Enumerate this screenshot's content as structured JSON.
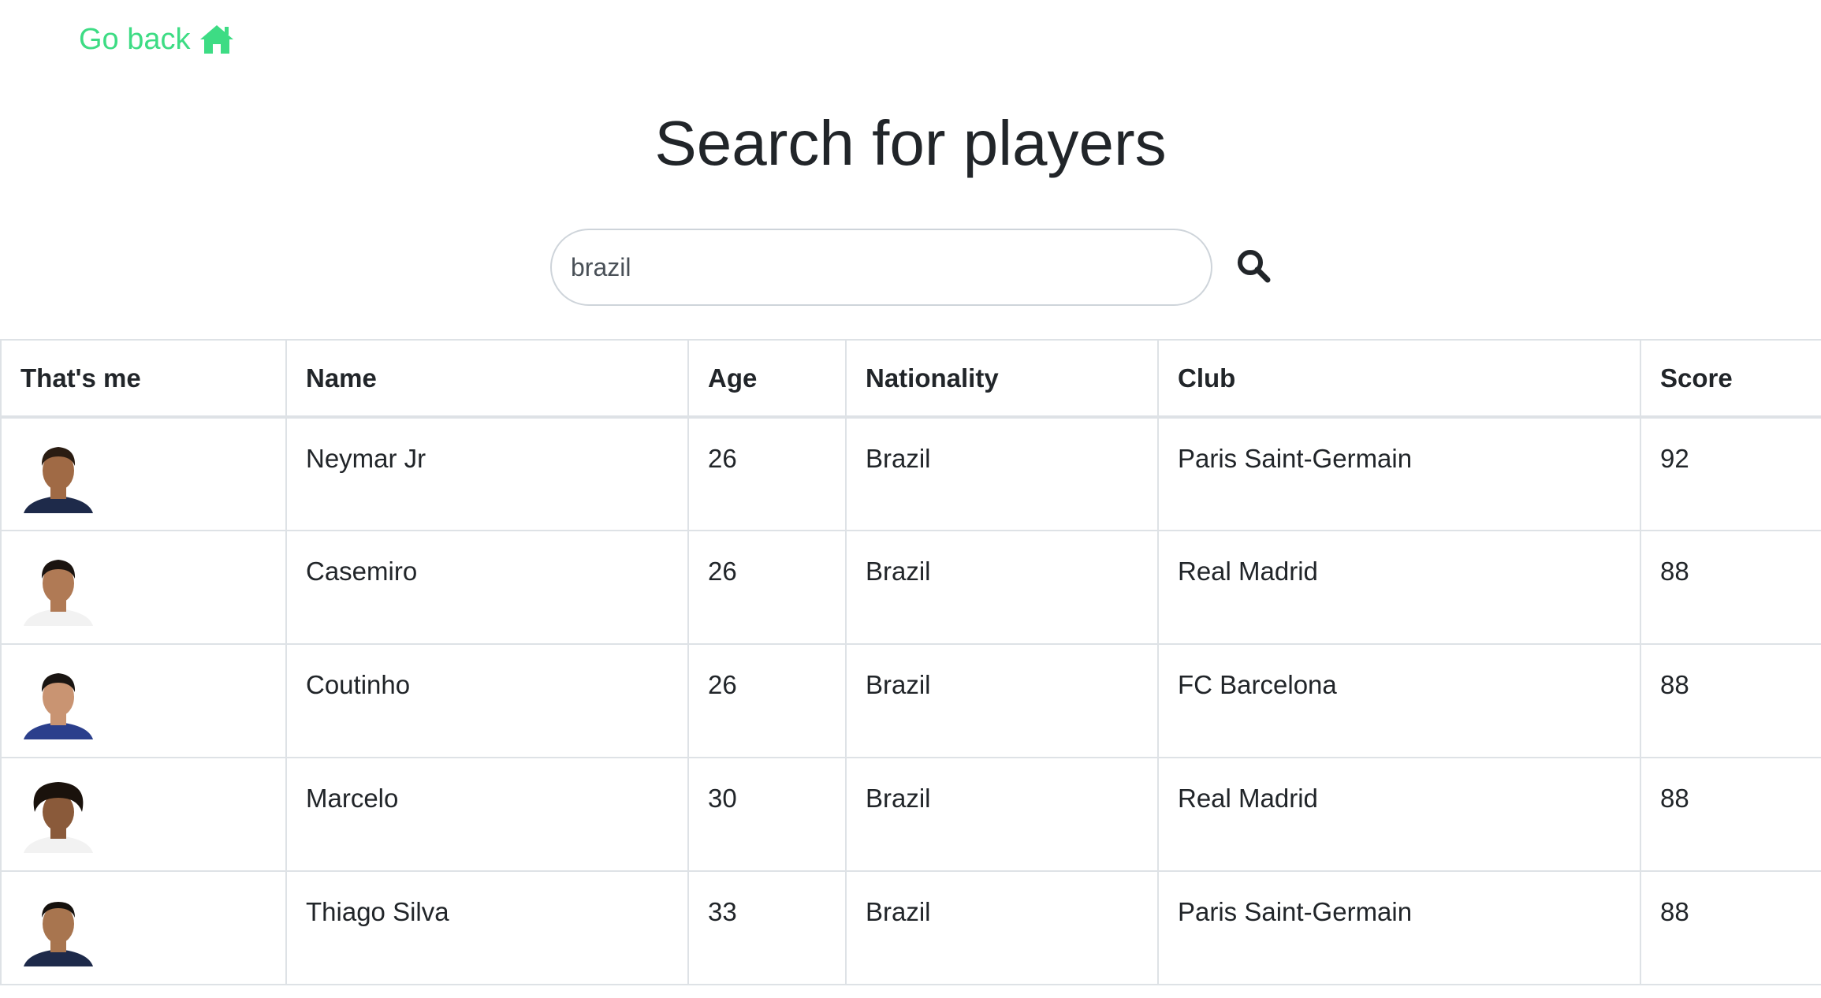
{
  "nav": {
    "go_back_label": "Go back",
    "home_icon": "home-icon"
  },
  "page": {
    "title": "Search for players"
  },
  "search": {
    "value": "brazil",
    "placeholder": "",
    "icon": "search-icon"
  },
  "table": {
    "headers": [
      "That's me",
      "Name",
      "Age",
      "Nationality",
      "Club",
      "Score"
    ],
    "rows": [
      {
        "name": "Neymar Jr",
        "age": "26",
        "nationality": "Brazil",
        "club": "Paris Saint-Germain",
        "score": "92",
        "shirt": "#1e2a4a",
        "hair": "#2a1c12",
        "skin": "#a06a45"
      },
      {
        "name": "Casemiro",
        "age": "26",
        "nationality": "Brazil",
        "club": "Real Madrid",
        "score": "88",
        "shirt": "#f2f2f2",
        "hair": "#1b1410",
        "skin": "#b07a55"
      },
      {
        "name": "Coutinho",
        "age": "26",
        "nationality": "Brazil",
        "club": "FC Barcelona",
        "score": "88",
        "shirt": "#2b3f8c",
        "hair": "#1a1512",
        "skin": "#c99472"
      },
      {
        "name": "Marcelo",
        "age": "30",
        "nationality": "Brazil",
        "club": "Real Madrid",
        "score": "88",
        "shirt": "#f2f2f2",
        "hair": "#1a120c",
        "skin": "#8a5a3a"
      },
      {
        "name": "Thiago Silva",
        "age": "33",
        "nationality": "Brazil",
        "club": "Paris Saint-Germain",
        "score": "88",
        "shirt": "#1e2a4a",
        "hair": "#15110e",
        "skin": "#a8754f"
      }
    ]
  },
  "colors": {
    "accent": "#3ddc84",
    "text": "#212529",
    "border": "#dee2e6"
  }
}
